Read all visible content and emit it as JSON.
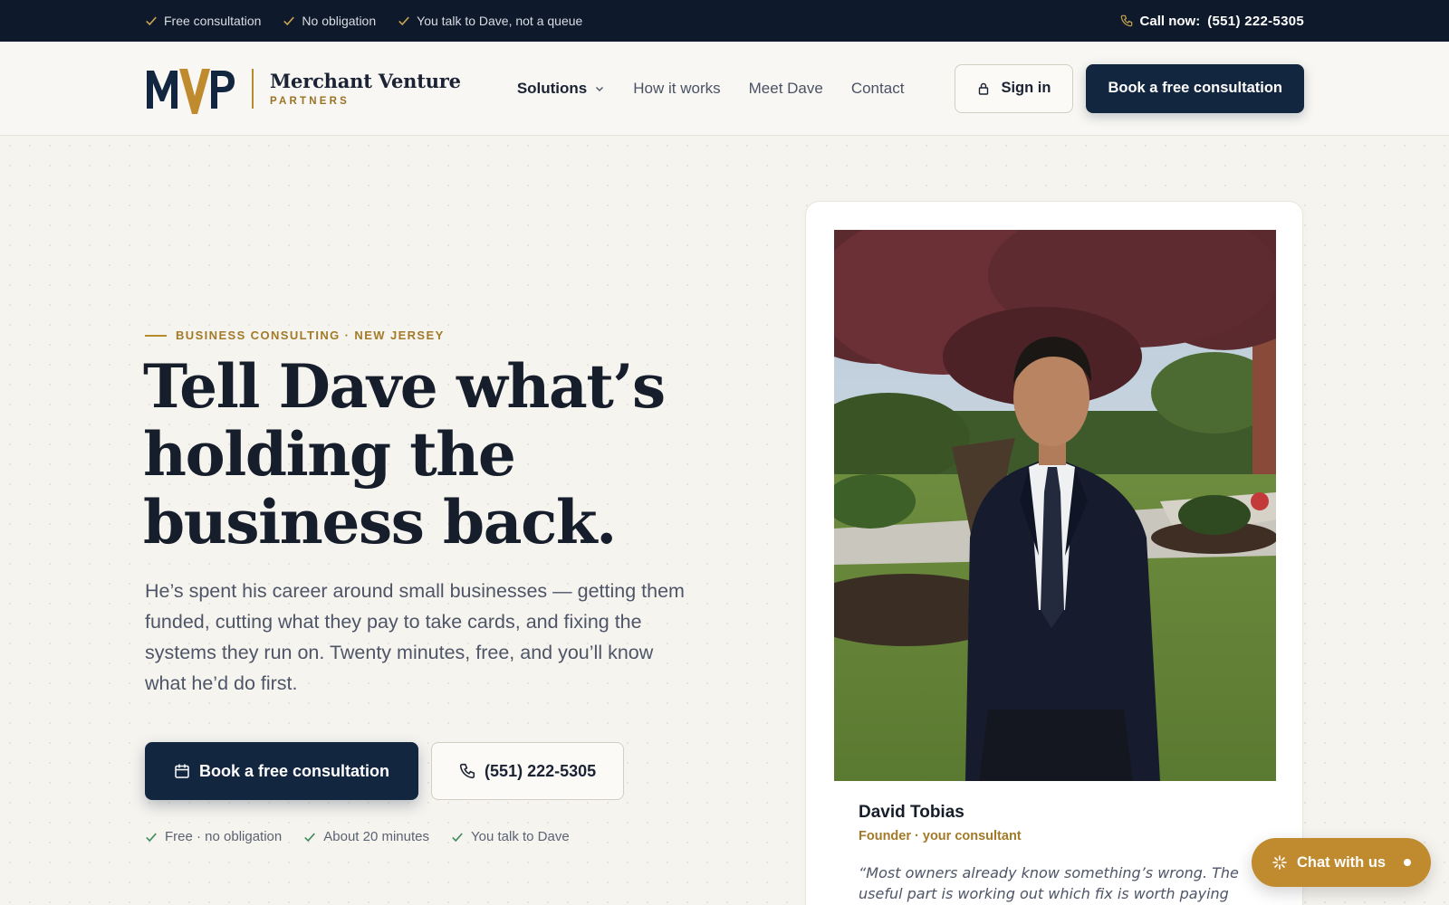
{
  "topbar": {
    "perks": [
      "Free consultation",
      "No obligation",
      "You talk to Dave, not a queue"
    ],
    "call_label": "Call now:",
    "call_number": "(551) 222-5305"
  },
  "brand": {
    "mark": "MVP",
    "name": "Merchant Venture",
    "sub": "PARTNERS",
    "colors": {
      "navy": "#132640",
      "gold": "#b88a2e"
    }
  },
  "nav": {
    "items": [
      {
        "label": "Solutions",
        "has_dropdown": true
      },
      {
        "label": "How it works"
      },
      {
        "label": "Meet Dave"
      },
      {
        "label": "Contact"
      }
    ],
    "sign_in": "Sign in",
    "book_cta": "Book a free consultation"
  },
  "hero": {
    "eyebrow": "BUSINESS CONSULTING · NEW JERSEY",
    "headline_lines": [
      "Tell Dave what’s",
      "holding the",
      "business back."
    ],
    "lede": "He’s spent his career around small businesses — getting them funded, cutting what they pay to take cards, and fixing the systems they run on. Twenty minutes, free, and you’ll know what he’d do first.",
    "primary_cta": "Book a free consultation",
    "secondary_cta": "(551) 222-5305",
    "reassurances": [
      "Free · no obligation",
      "About 20 minutes",
      "You talk to Dave"
    ]
  },
  "profile": {
    "name": "David Tobias",
    "role": "Founder · your consultant",
    "quote": "“Most owners already know something’s wrong. The useful part is working out which fix is worth paying for first.”"
  },
  "chat": {
    "label": "Chat with us",
    "icon": "sparkle-icon"
  }
}
